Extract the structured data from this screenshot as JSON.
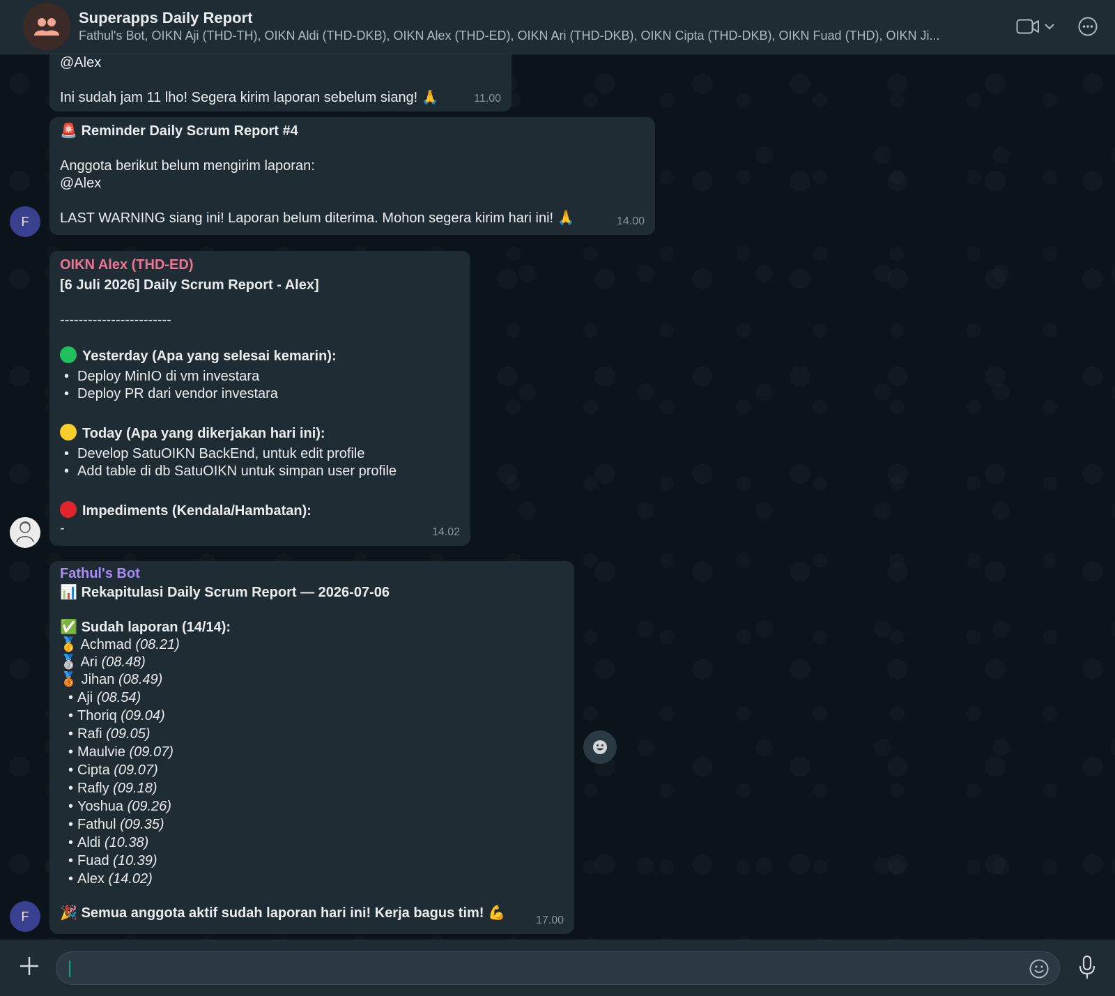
{
  "header": {
    "title": "Superapps Daily Report",
    "participants": "Fathul's Bot, OIKN Aji (THD-TH), OIKN Aldi (THD-DKB), OIKN Alex (THD-ED), OIKN Ari (THD-DKB), OIKN Cipta (THD-DKB), OIKN Fuad (THD), OIKN Ji..."
  },
  "colors": {
    "accent": "#00a884",
    "sender_alex": "#f07594",
    "sender_bot": "#a68cf5",
    "bubble": "#202c33",
    "background": "#0b141a"
  },
  "avatars": {
    "bot_initial": "F"
  },
  "messages": {
    "m1": {
      "mention": "@Alex",
      "text": "Ini sudah jam 11 lho! Segera kirim laporan sebelum siang! 🙏",
      "time": "11.00"
    },
    "m2": {
      "title": "Reminder Daily Scrum Report #4",
      "icon": "🚨",
      "line1": "Anggota berikut belum mengirim laporan:",
      "mention": "@Alex",
      "warning": "LAST WARNING siang ini! Laporan belum diterima. Mohon segera kirim hari ini! 🙏",
      "time": "14.00"
    },
    "m3": {
      "sender": "OIKN Alex (THD-ED)",
      "title": "[6 Juli 2026] Daily Scrum Report - Alex]",
      "divider": "------------------------",
      "yesterday_label": "Yesterday (Apa yang selesai kemarin):",
      "yesterday_items": [
        "Deploy MinIO di vm investara",
        "Deploy PR dari vendor investara"
      ],
      "today_label": "Today (Apa yang dikerjakan hari ini):",
      "today_items": [
        "Develop SatuOIKN BackEnd, untuk edit profile",
        "Add table di db SatuOIKN untuk simpan user profile"
      ],
      "impediments_label": "Impediments (Kendala/Hambatan):",
      "impediments_value": "-",
      "time": "14.02"
    },
    "m4": {
      "sender": "Fathul's Bot",
      "title": "Rekapitulasi Daily Scrum Report — 2026-07-06",
      "title_icon": "📊",
      "done_label": "Sudah laporan (14/14):",
      "done_icon": "✅",
      "medalists": [
        {
          "medal": "🥇",
          "name": "Achmad",
          "time": "(08.21)"
        },
        {
          "medal": "🥈",
          "name": "Ari",
          "time": "(08.48)"
        },
        {
          "medal": "🥉",
          "name": "Jihan",
          "time": "(08.49)"
        }
      ],
      "others": [
        {
          "name": "Aji",
          "time": "(08.54)"
        },
        {
          "name": "Thoriq",
          "time": "(09.04)"
        },
        {
          "name": "Rafi",
          "time": "(09.05)"
        },
        {
          "name": "Maulvie",
          "time": "(09.07)"
        },
        {
          "name": "Cipta",
          "time": "(09.07)"
        },
        {
          "name": "Rafly",
          "time": "(09.18)"
        },
        {
          "name": "Yoshua",
          "time": "(09.26)"
        },
        {
          "name": "Fathul",
          "time": "(09.35)"
        },
        {
          "name": "Aldi",
          "time": "(10.38)"
        },
        {
          "name": "Fuad",
          "time": "(10.39)"
        },
        {
          "name": "Alex",
          "time": "(14.02)"
        }
      ],
      "closing_icon": "🎉",
      "closing": "Semua anggota aktif sudah laporan hari ini! Kerja bagus tim! 💪",
      "time": "17.00"
    }
  },
  "composer": {
    "value": "",
    "placeholder": ""
  },
  "icons": {
    "header_group": "group-icon",
    "video": "video-call-icon",
    "dropdown": "chevron-down-icon",
    "menu": "more-options-icon",
    "react": "emoji-reaction-icon",
    "attach": "plus-icon",
    "emoji": "emoji-icon",
    "mic": "microphone-icon"
  }
}
